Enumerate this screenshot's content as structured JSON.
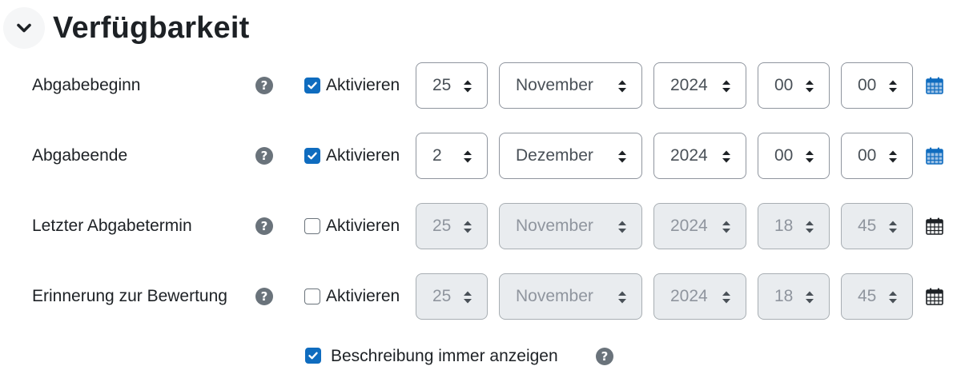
{
  "section": {
    "title": "Verfügbarkeit",
    "collapse_icon": "chevron-down-icon"
  },
  "colors": {
    "accent": "#0f6cbf",
    "text": "#1d2125",
    "help_icon": "#6a737b",
    "disabled_bg": "#e9ecef",
    "calendar_active": "#0f6cbf",
    "calendar_inactive": "#1d2125"
  },
  "rows": [
    {
      "label": "Abgabebeginn",
      "enabled": true,
      "enable_label": "Aktivieren",
      "day": "25",
      "month": "November",
      "year": "2024",
      "hour": "00",
      "minute": "00"
    },
    {
      "label": "Abgabeende",
      "enabled": true,
      "enable_label": "Aktivieren",
      "day": "2",
      "month": "Dezember",
      "year": "2024",
      "hour": "00",
      "minute": "00"
    },
    {
      "label": "Letzter Abgabetermin",
      "enabled": false,
      "enable_label": "Aktivieren",
      "day": "25",
      "month": "November",
      "year": "2024",
      "hour": "18",
      "minute": "45"
    },
    {
      "label": "Erinnerung zur Bewertung",
      "enabled": false,
      "enable_label": "Aktivieren",
      "day": "25",
      "month": "November",
      "year": "2024",
      "hour": "18",
      "minute": "45"
    }
  ],
  "always_show_description": {
    "label": "Beschreibung immer anzeigen",
    "checked": true
  },
  "icons": {
    "help": "question-circle-icon",
    "calendar": "calendar-icon",
    "select_caret": "sort-caret-icon",
    "checkbox_check": "check-icon"
  }
}
